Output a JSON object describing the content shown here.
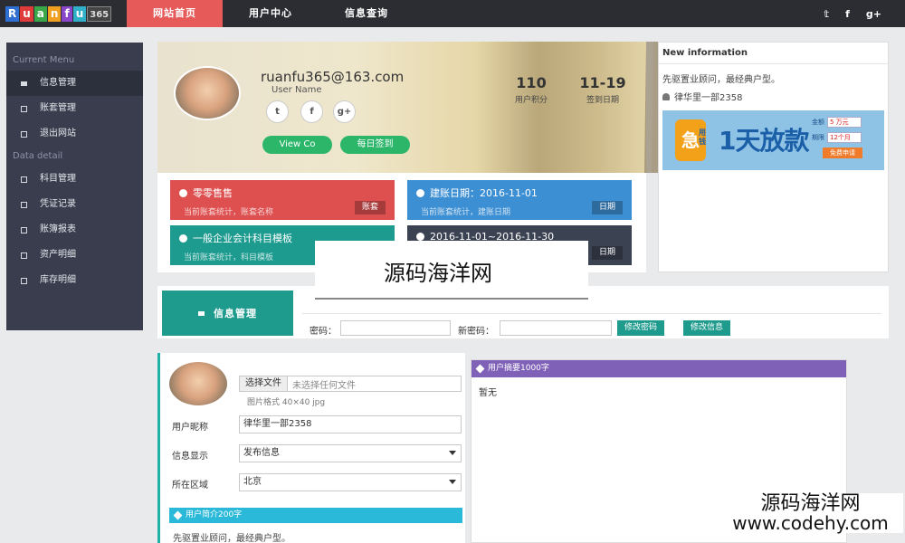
{
  "logo": {
    "letters": [
      "R",
      "u",
      "a",
      "n",
      "f",
      "u"
    ],
    "number": "365",
    "colors": [
      "#2f6fd1",
      "#e03b3b",
      "#3aa84a",
      "#f0a020",
      "#8a46c8",
      "#2fb0c8"
    ]
  },
  "nav": {
    "items": [
      {
        "label": "网站首页",
        "active": true
      },
      {
        "label": "用户中心"
      },
      {
        "label": "信息查询"
      }
    ]
  },
  "social": {
    "twitter": "𝕥",
    "facebook": "f",
    "google": "g+"
  },
  "sidebar": {
    "section1": "Current Menu",
    "items1": [
      {
        "label": "信息管理",
        "active": true
      },
      {
        "label": "账套管理"
      },
      {
        "label": "退出网站"
      }
    ],
    "section2": "Data detail",
    "items2": [
      {
        "label": "科目管理"
      },
      {
        "label": "凭证记录"
      },
      {
        "label": "账簿报表"
      },
      {
        "label": "资产明细"
      },
      {
        "label": "库存明细"
      }
    ]
  },
  "profile": {
    "email": "ruanfu365@163.com",
    "username_label": "User Name",
    "points_value": "110",
    "points_label": "用户积分",
    "signin_value": "11-19",
    "signin_label": "签到日期",
    "view_button": "View Co",
    "signin_button": "每日签到",
    "social_labels": [
      "t",
      "f",
      "g+"
    ]
  },
  "tiles": [
    {
      "title": "零零售售",
      "sub": "当前账套统计，账套名称",
      "tag": "账套",
      "color": "#de4f4f"
    },
    {
      "title": "建账日期：2016-11-01",
      "sub": "当前账套统计，建账日期",
      "tag": "日期",
      "color": "#3d8fd3"
    },
    {
      "title": "一般企业会计科目模板",
      "sub": "当前账套统计，科目模板",
      "tag": "",
      "color": "#1d9b8f"
    },
    {
      "title": "2016-11-01~2016-11-30",
      "sub": "",
      "tag": "日期",
      "color": "#3b4252"
    }
  ],
  "new_info": {
    "title": "New information",
    "line1": "先驱置业顾问，最经典户型。",
    "line2": "律华里一部2358",
    "banner": {
      "ji": "急",
      "yong": "用钱",
      "big": "1天放款",
      "amount_label": "金额",
      "amount_value": "5 万元",
      "term_label": "期限",
      "term_value": "12个月",
      "apply": "免费申请"
    }
  },
  "manage": {
    "label": "信息管理",
    "password_label": "密码：",
    "new_password_label": "新密码：",
    "change_password": "修改密码",
    "change_info": "修改信息"
  },
  "watermark": {
    "center": "源码海洋网",
    "corner_cn": "源码海洋网",
    "corner_url": "www.codehy.com"
  },
  "form": {
    "choose_file": "选择文件",
    "no_file": "未选择任何文件",
    "image_format": "图片格式 40×40 jpg",
    "nickname_label": "用户昵称",
    "nickname_value": "律华里一部2358",
    "display_label": "信息显示",
    "display_value": "发布信息",
    "region_label": "所在区域",
    "region_value": "北京",
    "intro_title": "用户简介200字",
    "intro_text": "先驱置业顾问，最经典户型。"
  },
  "summary": {
    "title": "用户摘要1000字",
    "text": "暂无"
  }
}
